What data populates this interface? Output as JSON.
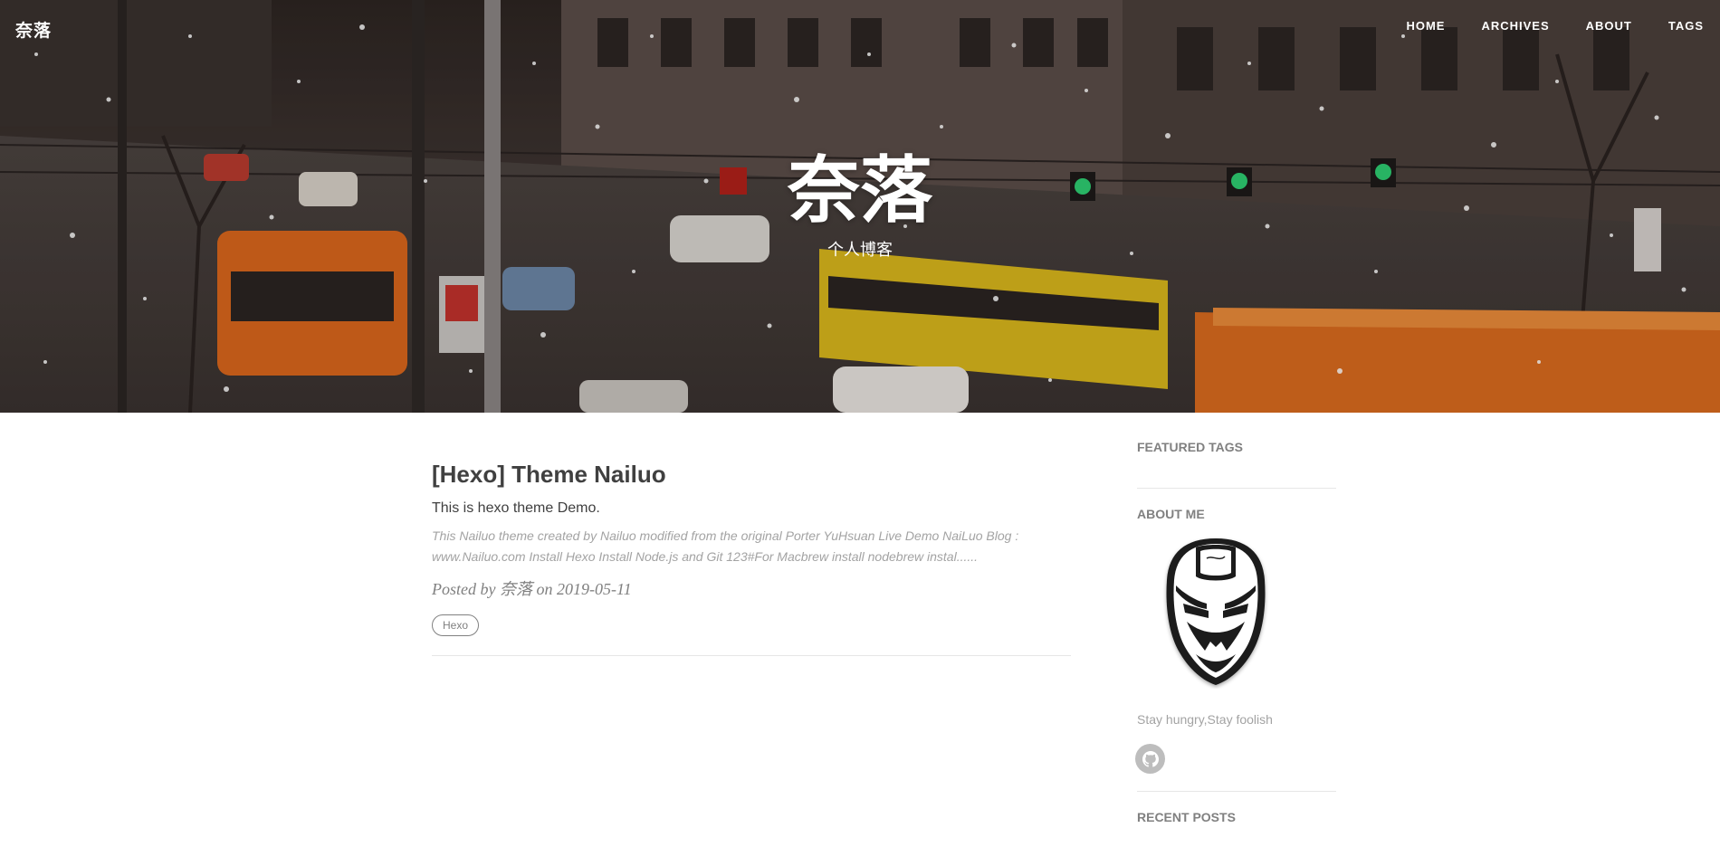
{
  "header": {
    "brand": "奈落",
    "nav": [
      "HOME",
      "ARCHIVES",
      "ABOUT",
      "TAGS"
    ],
    "hero_title": "奈落",
    "hero_subtitle": "个人博客"
  },
  "post": {
    "title": "[Hexo] Theme Nailuo",
    "subtitle": "This is hexo theme Demo.",
    "excerpt_line1": "This Nailuo theme created by Nailuo modified from the original Porter YuHsuan Live Demo NaiLuo Blog :",
    "excerpt_line2": "www.Nailuo.com Install Hexo Install Node.js and Git 123#For Macbrew install nodebrew instal......",
    "meta_prefix": "Posted by",
    "meta_author": "奈落",
    "meta_on": "on",
    "meta_date": "2019-05-11",
    "tag": "Hexo"
  },
  "sidebar": {
    "featured_tags": "FEATURED TAGS",
    "about_me": "ABOUT ME",
    "motto": "Stay hungry,Stay foolish",
    "recent_posts": "RECENT POSTS"
  },
  "icons": {
    "avatar": "iron-man-mask-icon",
    "social": "github-icon"
  },
  "colors": {
    "text_dark": "#404040",
    "text_muted": "#808080",
    "text_light": "#a3a3a3",
    "divider": "#e6e6e6",
    "social_bg": "#bdbdbd"
  }
}
